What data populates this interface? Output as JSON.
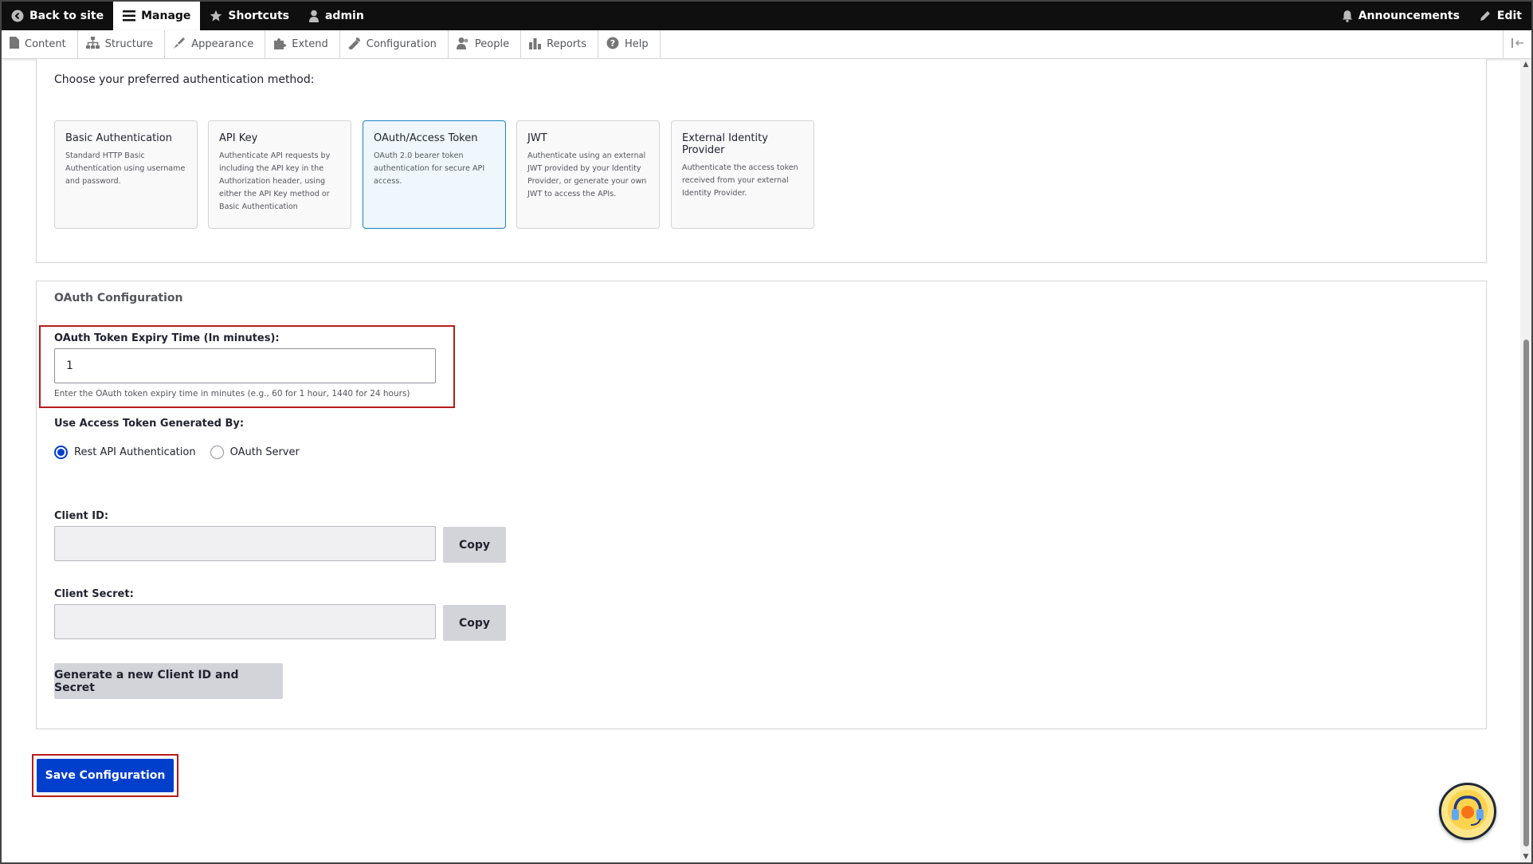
{
  "toolbar": {
    "back_to_site": "Back to site",
    "manage": "Manage",
    "shortcuts": "Shortcuts",
    "user": "admin",
    "announcements": "Announcements",
    "edit": "Edit"
  },
  "tray": {
    "items": [
      {
        "label": "Content",
        "icon": "page-icon"
      },
      {
        "label": "Structure",
        "icon": "sitemap-icon"
      },
      {
        "label": "Appearance",
        "icon": "brush-icon"
      },
      {
        "label": "Extend",
        "icon": "puzzle-icon"
      },
      {
        "label": "Configuration",
        "icon": "wrench-icon"
      },
      {
        "label": "People",
        "icon": "people-icon"
      },
      {
        "label": "Reports",
        "icon": "bar-chart-icon"
      },
      {
        "label": "Help",
        "icon": "help-icon"
      }
    ]
  },
  "auth": {
    "intro": "Choose your preferred authentication method:",
    "methods": [
      {
        "title": "Basic Authentication",
        "desc": "Standard HTTP Basic Authentication using username and password."
      },
      {
        "title": "API Key",
        "desc": "Authenticate API requests by including the API key in the Authorization header, using either the API Key method or Basic Authentication"
      },
      {
        "title": "OAuth/Access Token",
        "desc": "OAuth 2.0 bearer token authentication for secure API access."
      },
      {
        "title": "JWT",
        "desc": "Authenticate using an external JWT provided by your Identity Provider, or generate your own JWT to access the APIs."
      },
      {
        "title": "External Identity Provider",
        "desc": "Authenticate the access token received from your external Identity Provider."
      }
    ],
    "selected": "OAuth/Access Token"
  },
  "oauth": {
    "section_title": "OAuth Configuration",
    "expiry_label": "OAuth Token Expiry Time (In minutes):",
    "expiry_value": "1",
    "expiry_hint": "Enter the OAuth token expiry time in minutes (e.g., 60 for 1 hour, 1440 for 24 hours)",
    "generated_by_label": "Use Access Token Generated By:",
    "radio_options": [
      "Rest API Authentication",
      "OAuth Server"
    ],
    "radio_selected": "Rest API Authentication",
    "client_id_label": "Client ID:",
    "client_id_value": "",
    "client_secret_label": "Client Secret:",
    "client_secret_value": "",
    "copy_label": "Copy",
    "generate_label": "Generate a new Client ID and Secret"
  },
  "save_label": "Save Configuration"
}
